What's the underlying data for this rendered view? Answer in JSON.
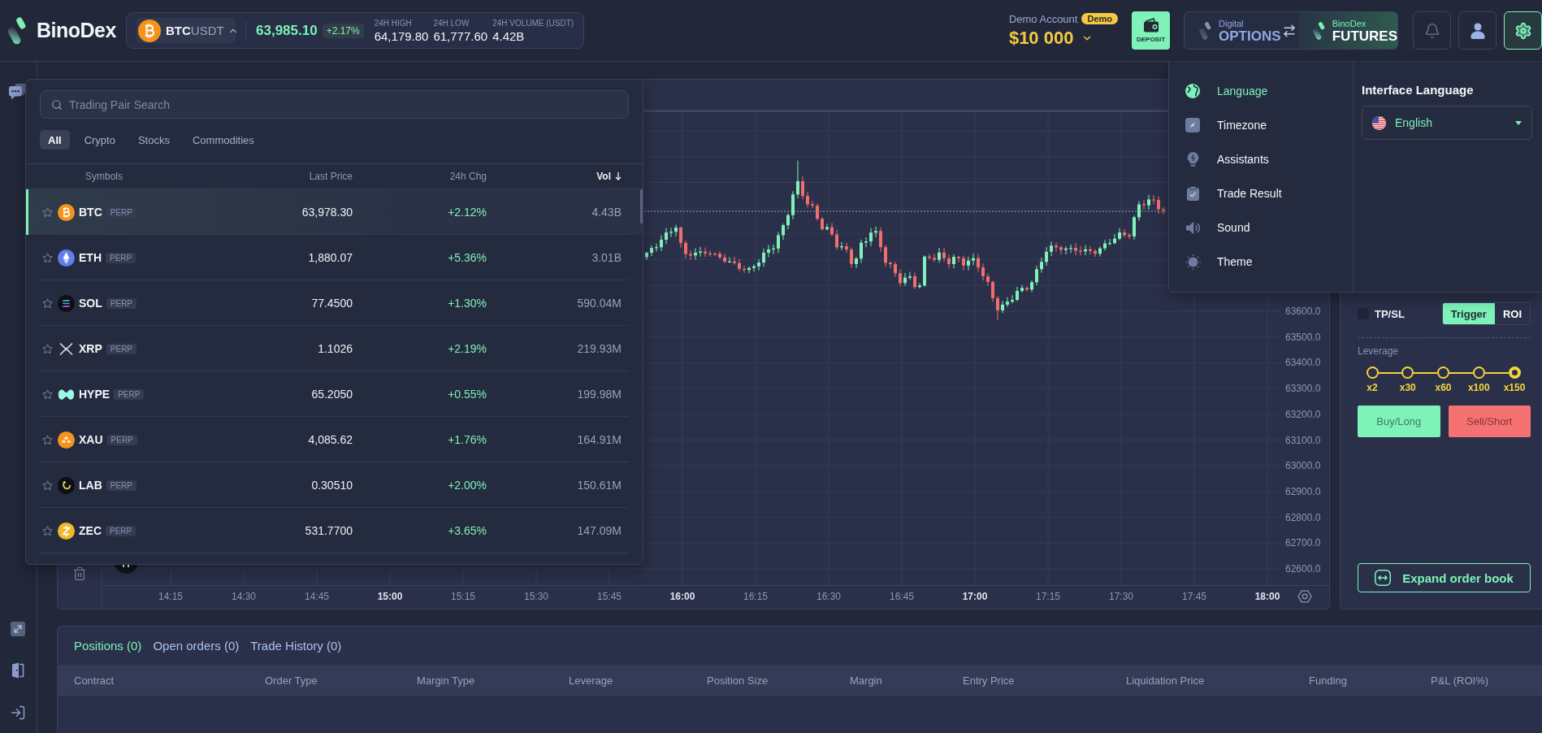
{
  "header": {
    "logo": "BinoDex",
    "ticker": {
      "base": "BTC",
      "quote": "USDT",
      "price": "63,985.10",
      "change": "+2.17%",
      "stats": [
        {
          "label": "24H HIGH",
          "value": "64,179.80"
        },
        {
          "label": "24H LOW",
          "value": "61,777.60"
        },
        {
          "label": "24H VOLUME (USDT)",
          "value": "4.42B"
        }
      ]
    },
    "account": {
      "label": "Demo Account",
      "badge": "Demo",
      "balance": "$10 000"
    },
    "deposit": "DEPOSIT",
    "modes": [
      {
        "caption": "Digital",
        "label": "OPTIONS",
        "selected": false
      },
      {
        "caption": "BinoDex",
        "label": "FUTURES",
        "selected": true
      }
    ],
    "icon_buttons": [
      {
        "kind": "bell",
        "selected": false
      },
      {
        "kind": "user",
        "selected": false
      },
      {
        "kind": "settings",
        "selected": true
      }
    ]
  },
  "settings_menu": {
    "items": [
      {
        "kind": "globe",
        "label": "Language",
        "selected": true
      },
      {
        "kind": "compass",
        "label": "Timezone",
        "selected": false
      },
      {
        "kind": "bulb",
        "label": "Assistants",
        "selected": false
      },
      {
        "kind": "clipboard",
        "label": "Trade Result",
        "selected": false
      },
      {
        "kind": "speaker",
        "label": "Sound",
        "selected": false
      },
      {
        "kind": "sun",
        "label": "Theme",
        "selected": false
      }
    ],
    "title": "Interface Language",
    "language": "English"
  },
  "pair_menu": {
    "search": {
      "placeholder": "Trading Pair Search"
    },
    "tabs": [
      {
        "label": "All",
        "selected": true
      },
      {
        "label": "Crypto",
        "selected": false
      },
      {
        "label": "Stocks",
        "selected": false
      },
      {
        "label": "Commodities",
        "selected": false
      }
    ],
    "columns": [
      {
        "label": "Symbols",
        "sorted": false
      },
      {
        "label": "Last Price",
        "sorted": false
      },
      {
        "label": "24h Chg",
        "sorted": false
      },
      {
        "label": "Vol",
        "sorted": true
      }
    ],
    "rows": [
      {
        "symbol": "BTC",
        "badge": "PERP",
        "price": "63,978.30",
        "change": "+2.12%",
        "volume": "4.43B",
        "starred": false,
        "selected": true
      },
      {
        "symbol": "ETH",
        "badge": "PERP",
        "price": "1,880.07",
        "change": "+5.36%",
        "volume": "3.01B",
        "starred": false,
        "selected": false
      },
      {
        "symbol": "SOL",
        "badge": "PERP",
        "price": "77.4500",
        "change": "+1.30%",
        "volume": "590.04M",
        "starred": false,
        "selected": false
      },
      {
        "symbol": "XRP",
        "badge": "PERP",
        "price": "1.1026",
        "change": "+2.19%",
        "volume": "219.93M",
        "starred": false,
        "selected": false
      },
      {
        "symbol": "HYPE",
        "badge": "PERP",
        "price": "65.2050",
        "change": "+0.55%",
        "volume": "199.98M",
        "starred": false,
        "selected": false
      },
      {
        "symbol": "XAU",
        "badge": "PERP",
        "price": "4,085.62",
        "change": "+1.76%",
        "volume": "164.91M",
        "starred": false,
        "selected": false
      },
      {
        "symbol": "LAB",
        "badge": "PERP",
        "price": "0.30510",
        "change": "+2.00%",
        "volume": "150.61M",
        "starred": false,
        "selected": false
      },
      {
        "symbol": "ZEC",
        "badge": "PERP",
        "price": "531.7700",
        "change": "+3.65%",
        "volume": "147.09M",
        "starred": false,
        "selected": false
      }
    ]
  },
  "chart": {
    "price_labels": [
      "63600.0",
      "63500.0",
      "63400.0",
      "63300.0",
      "63200.0",
      "63100.0",
      "63000.0",
      "62900.0",
      "62800.0",
      "62700.0",
      "62600.0"
    ],
    "time_labels": [
      {
        "label": "14:15",
        "major": false
      },
      {
        "label": "14:30",
        "major": false
      },
      {
        "label": "14:45",
        "major": false
      },
      {
        "label": "15:00",
        "major": true
      },
      {
        "label": "15:15",
        "major": false
      },
      {
        "label": "15:30",
        "major": false
      },
      {
        "label": "15:45",
        "major": false
      },
      {
        "label": "16:00",
        "major": true
      },
      {
        "label": "16:15",
        "major": false
      },
      {
        "label": "16:30",
        "major": false
      },
      {
        "label": "16:45",
        "major": false
      },
      {
        "label": "17:00",
        "major": true
      },
      {
        "label": "17:15",
        "major": false
      },
      {
        "label": "17:30",
        "major": false
      },
      {
        "label": "17:45",
        "major": false
      },
      {
        "label": "18:00",
        "major": true
      }
    ]
  },
  "order_panel": {
    "tpsl": {
      "label": "TP/SL",
      "checked": false
    },
    "trigger_modes": [
      {
        "label": "Trigger",
        "selected": true
      },
      {
        "label": "ROI",
        "selected": false
      }
    ],
    "leverage": {
      "label": "Leverage",
      "stops": [
        {
          "label": "x2",
          "selected": false
        },
        {
          "label": "x30",
          "selected": false
        },
        {
          "label": "x60",
          "selected": false
        },
        {
          "label": "x100",
          "selected": false
        },
        {
          "label": "x150",
          "selected": true
        }
      ]
    },
    "buy": "Buy/Long",
    "sell": "Sell/Short",
    "expand": "Expand order book"
  },
  "positions": {
    "tabs": [
      {
        "label": "Positions (0)",
        "selected": true
      },
      {
        "label": "Open orders (0)",
        "selected": false
      },
      {
        "label": "Trade History (0)",
        "selected": false
      }
    ],
    "columns": [
      "Contract",
      "Order Type",
      "Margin Type",
      "Leverage",
      "Position Size",
      "Margin",
      "Entry Price",
      "Liquidation Price",
      "Funding",
      "P&L (ROI%)"
    ]
  }
}
